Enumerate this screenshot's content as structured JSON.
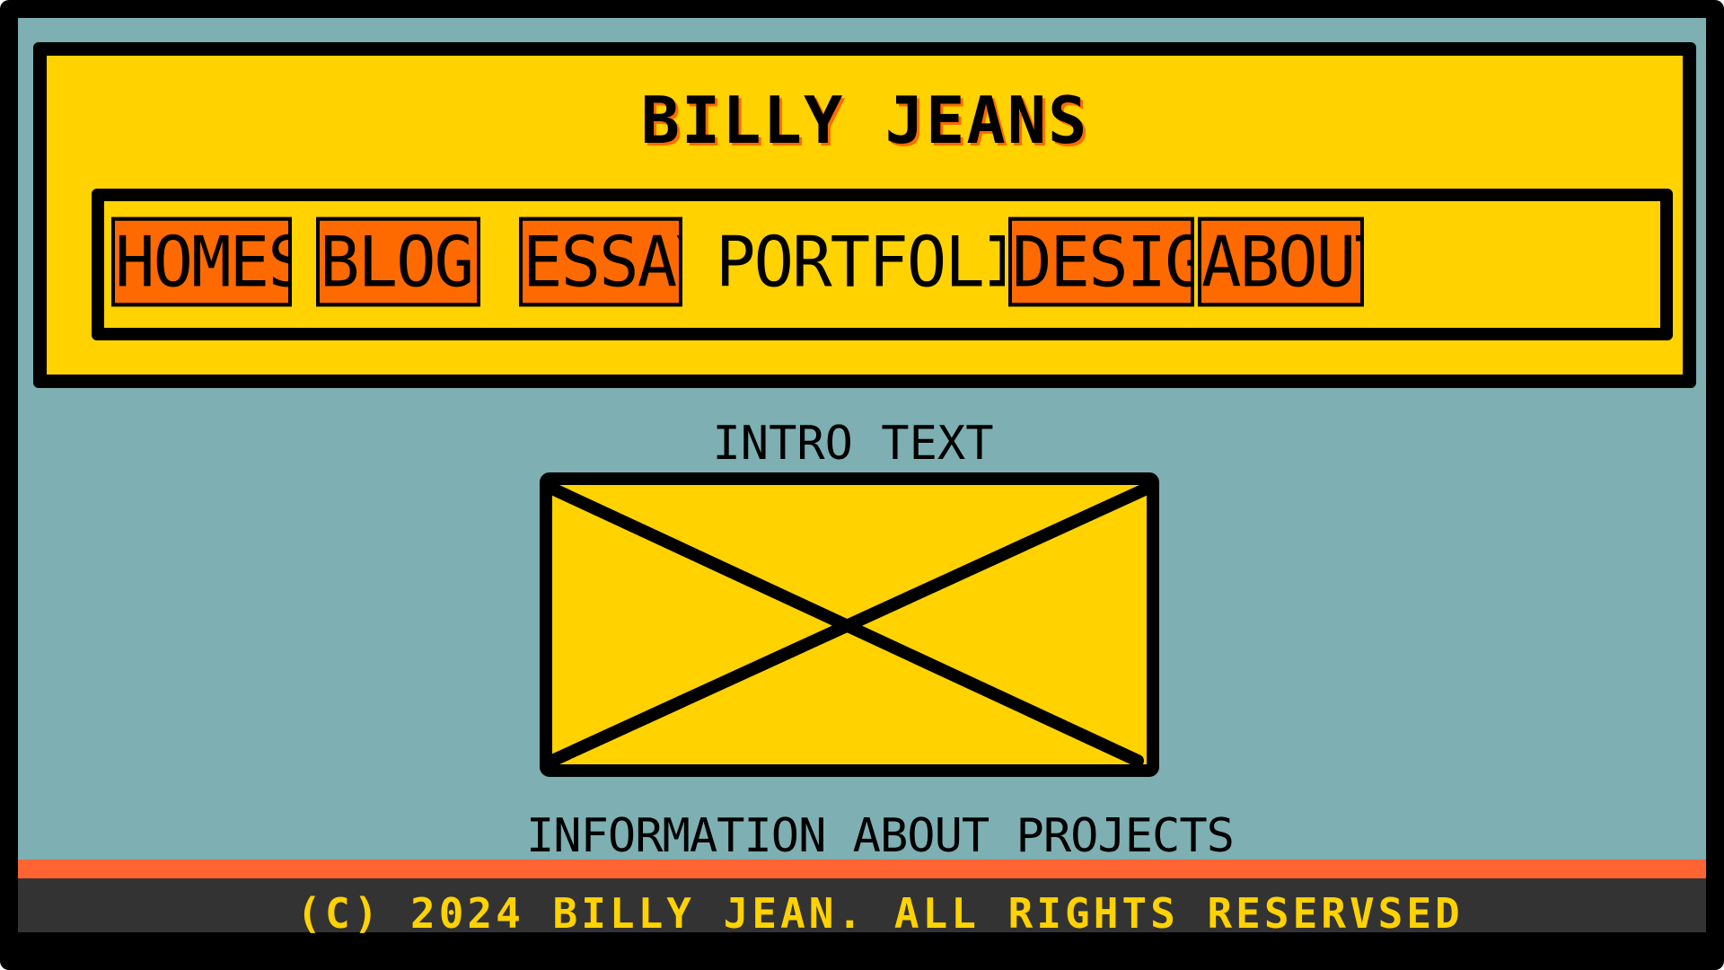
{
  "site": {
    "title": "BILLY JEANS"
  },
  "nav": {
    "items": [
      {
        "label": "HOMES"
      },
      {
        "label": "BLOGS"
      },
      {
        "label": "ESSAY"
      },
      {
        "label": "PORTFOLIO",
        "active": true
      },
      {
        "label": "DESIGN"
      },
      {
        "label": "ABOUT"
      }
    ]
  },
  "main": {
    "intro": "INTRO TEXT",
    "image_icon": "image-placeholder-icon",
    "projects": "INFORMATION ABOUT PROJECTS"
  },
  "footer": {
    "copyright": "(C) 2024 BILLY JEAN. ALL RIGHTS RESERVSED"
  },
  "colors": {
    "background": "#7eafb2",
    "header": "#ffd200",
    "nav_button": "#ff6a00",
    "footer": "#333333",
    "footer_accent": "#ff6432",
    "footer_text": "#ffd200"
  }
}
